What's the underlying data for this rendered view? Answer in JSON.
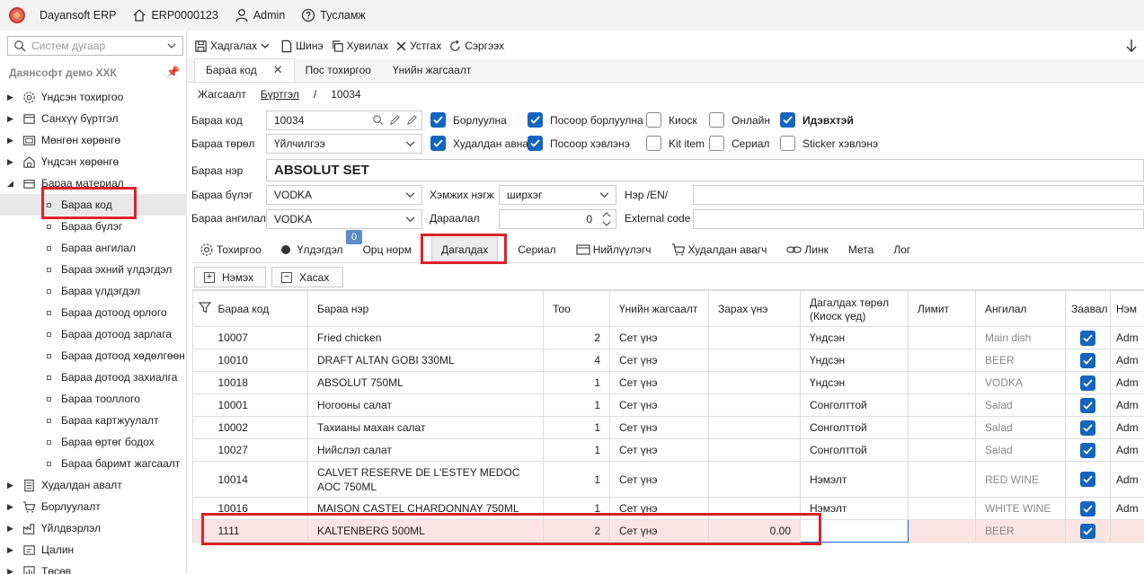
{
  "titlebar": {
    "app_name": "Dayansoft ERP",
    "erp_id": "ERP0000123",
    "user": "Admin",
    "help": "Тусламж"
  },
  "sidebar": {
    "search_placeholder": "Систем дугаар",
    "company": "Даянсофт демо ХХК",
    "items": [
      {
        "label": "Үндсэн тохиргоо",
        "icon": "gear-icon"
      },
      {
        "label": "Санхүү бүртгэл",
        "icon": "ledger-icon"
      },
      {
        "label": "Мөнгөн хөрөнгө",
        "icon": "money-icon"
      },
      {
        "label": "Үндсэн хөрөнгө",
        "icon": "building-icon"
      },
      {
        "label": "Бараа материал",
        "icon": "box-icon"
      }
    ],
    "children": [
      "Бараа код",
      "Бараа бүлэг",
      "Бараа ангилал",
      "Бараа эхний үлдэгдэл",
      "Бараа үлдэгдэл",
      "Бараа дотоод орлого",
      "Бараа дотоод зарлага",
      "Бараа дотоод хөдөлгөөн",
      "Бараа дотоод захиалга",
      "Бараа тооллого",
      "Бараа картжуулалт",
      "Бараа өртөг бодох",
      "Бараа баримт жагсаалт"
    ],
    "bottom_items": [
      {
        "label": "Худалдан авалт",
        "icon": "doc-icon"
      },
      {
        "label": "Борлуулалт",
        "icon": "cart-icon"
      },
      {
        "label": "Үйлдвэрлэл",
        "icon": "factory-icon"
      },
      {
        "label": "Цалин",
        "icon": "payroll-icon"
      },
      {
        "label": "Төсөв",
        "icon": "budget-icon"
      }
    ]
  },
  "toolbar": {
    "save": "Хадгалах",
    "new": "Шинэ",
    "copy": "Хувилах",
    "delete": "Устгах",
    "refresh": "Сэргээх"
  },
  "doctabs": [
    "Бараа код",
    "Пос тохиргоо",
    "Үнийн жагсаалт"
  ],
  "breadcrumb": [
    "Жагсаалт",
    "Бүртгэл",
    "/",
    "10034"
  ],
  "form": {
    "code_label": "Бараа код",
    "code_value": "10034",
    "type_label": "Бараа төрөл",
    "type_value": "Үйлчилгээ",
    "name_label": "Бараа нэр",
    "name_value": "ABSOLUT SET",
    "group_label": "Бараа бүлэг",
    "group_value": "VODKA",
    "category_label": "Бараа ангилал",
    "category_value": "VODKA",
    "unit_label": "Хэмжих нэгж",
    "unit_value": "ширхэг",
    "order_label": "Дараалал",
    "order_value": "0",
    "name_en_label": "Нэр /EN/",
    "external_label": "External code",
    "checks": [
      {
        "label": "Борлуулна",
        "checked": true
      },
      {
        "label": "Посоор борлуулна",
        "checked": true
      },
      {
        "label": "Киоск",
        "checked": false
      },
      {
        "label": "Онлайн",
        "checked": false
      },
      {
        "label": "Идэвхтэй",
        "checked": true
      },
      {
        "label": "Худалдан авна",
        "checked": true
      },
      {
        "label": "Посоор хэвлэнэ",
        "checked": true
      },
      {
        "label": "Kit item",
        "checked": false
      },
      {
        "label": "Сериал",
        "checked": false
      },
      {
        "label": "Sticker хэвлэнэ",
        "checked": false
      }
    ]
  },
  "subtabs": {
    "settings": "Тохиргоо",
    "balance": "Үлдэгдэл",
    "balance_badge": "0",
    "recipe": "Орц норм",
    "accompany": "Дагалдах",
    "serial": "Сериал",
    "supplier": "Нийлүүлэгч",
    "purchase": "Худалдан авагч",
    "link": "Линк",
    "meta": "Мета",
    "log": "Лог"
  },
  "grid_buttons": {
    "add": "Нэмэх",
    "remove": "Хасах"
  },
  "grid": {
    "headers": [
      "Бараа код",
      "Бараа нэр",
      "Тоо",
      "Үнийн жагсаалт",
      "Зарах үнэ",
      "Дагалдах төрөл (Киоск үед)",
      "Лимит",
      "Ангилал",
      "Заавал",
      "Нэм"
    ],
    "rows": [
      [
        "10007",
        "Fried chicken",
        "2",
        "Сет үнэ",
        "",
        "Үндсэн",
        "",
        "Main dish",
        "Adm"
      ],
      [
        "10010",
        "DRAFT ALTAN GOBI 330ML",
        "4",
        "Сет үнэ",
        "",
        "Үндсэн",
        "",
        "BEER",
        "Adm"
      ],
      [
        "10018",
        "ABSOLUT 750ML",
        "1",
        "Сет үнэ",
        "",
        "Үндсэн",
        "",
        "VODKA",
        "Adm"
      ],
      [
        "10001",
        "Ногооны салат",
        "1",
        "Сет үнэ",
        "",
        "Сонголттой",
        "",
        "Salad",
        "Adm"
      ],
      [
        "10002",
        "Тахианы махан салат",
        "1",
        "Сет үнэ",
        "",
        "Сонголттой",
        "",
        "Salad",
        "Adm"
      ],
      [
        "10027",
        "Нийслэл салат",
        "1",
        "Сет үнэ",
        "",
        "Сонголттой",
        "",
        "Salad",
        "Adm"
      ],
      [
        "10014",
        "CALVET RESERVE DE L'ESTEY MEDOC AOC 750ML",
        "1",
        "Сет үнэ",
        "",
        "Нэмэлт",
        "",
        "RED WINE",
        "Adm"
      ],
      [
        "10016",
        "MAISON CASTEL CHARDONNAY 750ML",
        "1",
        "Сет үнэ",
        "",
        "Нэмэлт",
        "",
        "WHITE WINE",
        "Adm"
      ],
      [
        "1111",
        "KALTENBERG 500ML",
        "2",
        "Сет үнэ",
        "0.00",
        "",
        "",
        "BEER",
        ""
      ]
    ]
  },
  "colors": {
    "accent": "#1565c0",
    "highlight_row": "#fde4e4",
    "annotation": "#e0202a"
  }
}
